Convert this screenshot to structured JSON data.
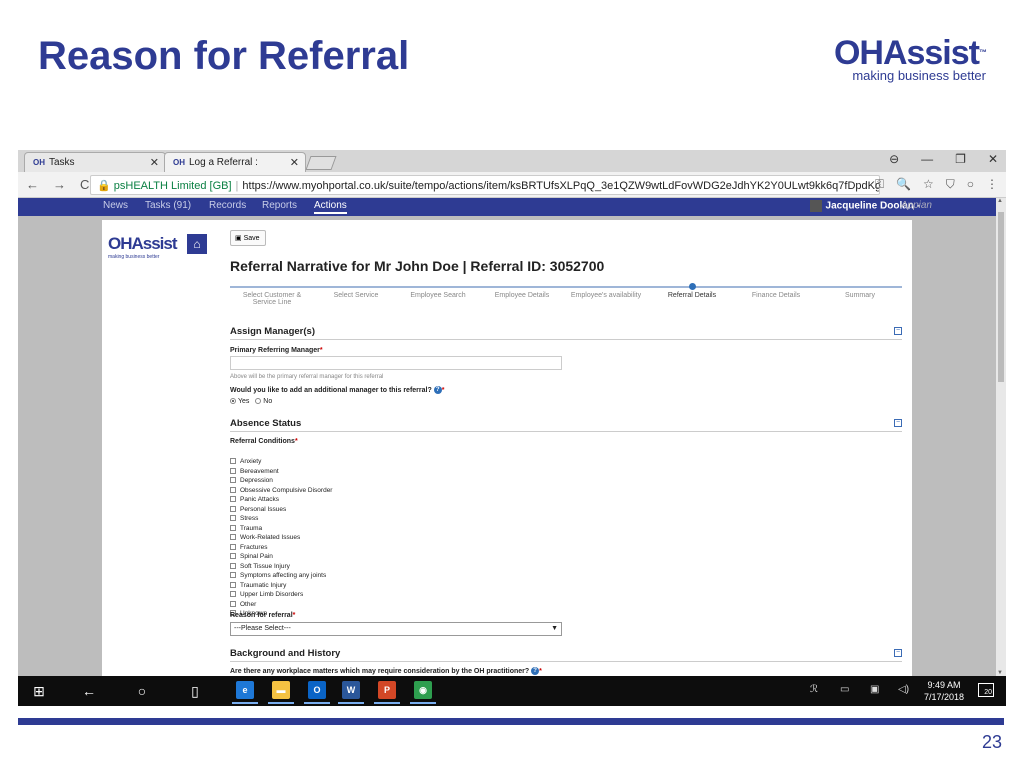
{
  "slide": {
    "title": "Reason for Referral",
    "brand_name": "OHAssist",
    "brand_tm": "™",
    "brand_tagline": "making business better",
    "page_number": "23",
    "accent_color": "#2e3b93"
  },
  "browser": {
    "tabs": [
      {
        "icon": "OH",
        "label": "Tasks",
        "close": "✕"
      },
      {
        "icon": "OH",
        "label": "Log a Referral :",
        "close": "✕"
      }
    ],
    "window_controls": [
      "⊖",
      "—",
      "❐",
      "✕"
    ],
    "nav": [
      "←",
      "→",
      "C"
    ],
    "secure_label": "🔒 psHEALTH Limited [GB]",
    "url": "https://www.myohportal.co.uk/suite/tempo/actions/item/ksBRTUfsXLPqQ_3e1QZW9wtLdFovWDG2eJdhYK2Y0ULwt9kk6q7fDpdKgVHcw6suoTZvj...",
    "address_icons": [
      "⚿",
      "🔍",
      "☆",
      "⛉",
      "○",
      "⋮"
    ]
  },
  "app_nav": {
    "items": [
      "News",
      "Tasks (91)",
      "Records",
      "Reports",
      "Actions"
    ],
    "active": "Actions",
    "user": "Jacqueline Doolan -",
    "platform": "Appian"
  },
  "page": {
    "logo_name": "OHAssist",
    "logo_tagline": "making business better",
    "home_icon": "⌂",
    "save_label": "Save",
    "title": "Referral Narrative for Mr John Doe | Referral ID: 3052700",
    "steps": [
      "Select Customer & Service Line",
      "Select Service",
      "Employee Search",
      "Employee Details",
      "Employee's availability",
      "Referral Details",
      "Finance Details",
      "Summary"
    ],
    "current_step": "Referral Details",
    "collapse_icon": "−",
    "sections": {
      "assign_manager": "Assign Manager(s)",
      "absence_status": "Absence Status",
      "background": "Background and History"
    },
    "primary_manager_label": "Primary Referring Manager",
    "required_mark": "*",
    "primary_manager_hint": "Above will be the primary referral manager for this referral",
    "additional_manager_question": "Would you like to add an additional manager to this referral?",
    "help_icon": "?",
    "radio_yes": "Yes",
    "radio_no": "No",
    "referral_conditions_label": "Referral Conditions",
    "conditions": [
      "Anxiety",
      "Bereavement",
      "Depression",
      "Obsessive Compulsive Disorder",
      "Panic Attacks",
      "Personal Issues",
      "Stress",
      "Trauma",
      "Work-Related Issues",
      "Fractures",
      "Spinal Pain",
      "Soft Tissue Injury",
      "Symptoms affecting any joints",
      "Traumatic Injury",
      "Upper Limb Disorders",
      "Other",
      "Unknown"
    ],
    "reason_label": "Reason for referral",
    "reason_select": "---Please Select---",
    "dropdown_arrow": "▼",
    "workplace_question": "Are there any workplace matters which may require consideration by the OH practitioner?"
  },
  "taskbar": {
    "start_icon": "⊞",
    "back_icon": "←",
    "cortana_icon": "○",
    "taskview_icon": "▯",
    "apps": [
      {
        "name": "edge",
        "glyph": "e",
        "color": "#1e78d7"
      },
      {
        "name": "explorer",
        "glyph": "▬",
        "color": "#f5c242"
      },
      {
        "name": "outlook",
        "glyph": "O",
        "color": "#0a64c6"
      },
      {
        "name": "word",
        "glyph": "W",
        "color": "#2b579a"
      },
      {
        "name": "powerpoint",
        "glyph": "P",
        "color": "#d24726"
      },
      {
        "name": "chrome",
        "glyph": "◉",
        "color": "#2e9e4f"
      }
    ],
    "tray": [
      "ℛ",
      "▭",
      "▣",
      "◁)"
    ],
    "time": "9:49 AM",
    "date": "7/17/2018",
    "notifications": "20"
  }
}
